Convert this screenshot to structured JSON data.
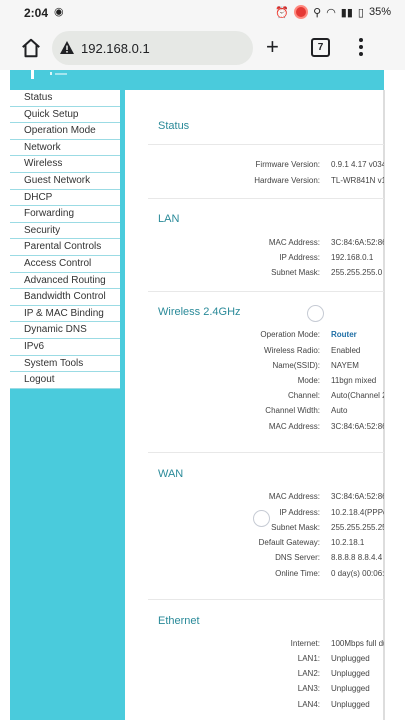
{
  "status_bar": {
    "time": "2:04",
    "battery": "35%",
    "left_icons": [
      "location-icon"
    ],
    "right_icons": [
      "alarm-icon",
      "record-icon",
      "location-pin-icon",
      "wifi-icon",
      "signal-icon",
      "battery-icon"
    ]
  },
  "browser": {
    "url": "192.168.0.1",
    "tab_count": "7"
  },
  "sidebar": {
    "items": [
      {
        "label": "Status"
      },
      {
        "label": "Quick Setup"
      },
      {
        "label": "Operation Mode"
      },
      {
        "label": "Network"
      },
      {
        "label": "Wireless"
      },
      {
        "label": "Guest Network"
      },
      {
        "label": "DHCP"
      },
      {
        "label": "Forwarding"
      },
      {
        "label": "Security"
      },
      {
        "label": "Parental Controls"
      },
      {
        "label": "Access Control"
      },
      {
        "label": "Advanced Routing"
      },
      {
        "label": "Bandwidth Control"
      },
      {
        "label": "IP & MAC Binding"
      },
      {
        "label": "Dynamic DNS"
      },
      {
        "label": "IPv6"
      },
      {
        "label": "System Tools"
      },
      {
        "label": "Logout"
      }
    ]
  },
  "status": {
    "title": "Status",
    "rows": [
      {
        "label": "Firmware Version:",
        "value": "0.9.1 4.17 v034"
      },
      {
        "label": "Hardware Version:",
        "value": "TL-WR841N v1"
      }
    ]
  },
  "lan": {
    "title": "LAN",
    "rows": [
      {
        "label": "MAC Address:",
        "value": "3C:84:6A:52:86"
      },
      {
        "label": "IP Address:",
        "value": "192.168.0.1"
      },
      {
        "label": "Subnet Mask:",
        "value": "255.255.255.0"
      }
    ]
  },
  "wireless": {
    "title": "Wireless 2.4GHz",
    "rows": [
      {
        "label": "Operation Mode:",
        "value": "Router"
      },
      {
        "label": "Wireless Radio:",
        "value": "Enabled"
      },
      {
        "label": "Name(SSID):",
        "value": "NAYEM"
      },
      {
        "label": "Mode:",
        "value": "11bgn mixed"
      },
      {
        "label": "Channel:",
        "value": "Auto(Channel 2"
      },
      {
        "label": "Channel Width:",
        "value": "Auto"
      },
      {
        "label": "MAC Address:",
        "value": "3C:84:6A:52:86"
      }
    ]
  },
  "wan": {
    "title": "WAN",
    "rows": [
      {
        "label": "MAC Address:",
        "value": "3C:84:6A:52:86"
      },
      {
        "label": "IP Address:",
        "value": "10.2.18.4(PPPo"
      },
      {
        "label": "Subnet Mask:",
        "value": "255.255.255.25"
      },
      {
        "label": "Default Gateway:",
        "value": "10.2.18.1"
      },
      {
        "label": "DNS Server:",
        "value": "8.8.8.8 8.8.4.4"
      },
      {
        "label": "Online Time:",
        "value": "0 day(s) 00:06:4"
      }
    ]
  },
  "ethernet": {
    "title": "Ethernet",
    "rows": [
      {
        "label": "Internet:",
        "value": "100Mbps full du"
      },
      {
        "label": "LAN1:",
        "value": "Unplugged"
      },
      {
        "label": "LAN2:",
        "value": "Unplugged"
      },
      {
        "label": "LAN3:",
        "value": "Unplugged"
      },
      {
        "label": "LAN4:",
        "value": "Unplugged"
      }
    ]
  },
  "colors": {
    "accent": "#4acbdc",
    "section_title": "#2a8a99",
    "highlight_value": "#1f6fa6"
  }
}
